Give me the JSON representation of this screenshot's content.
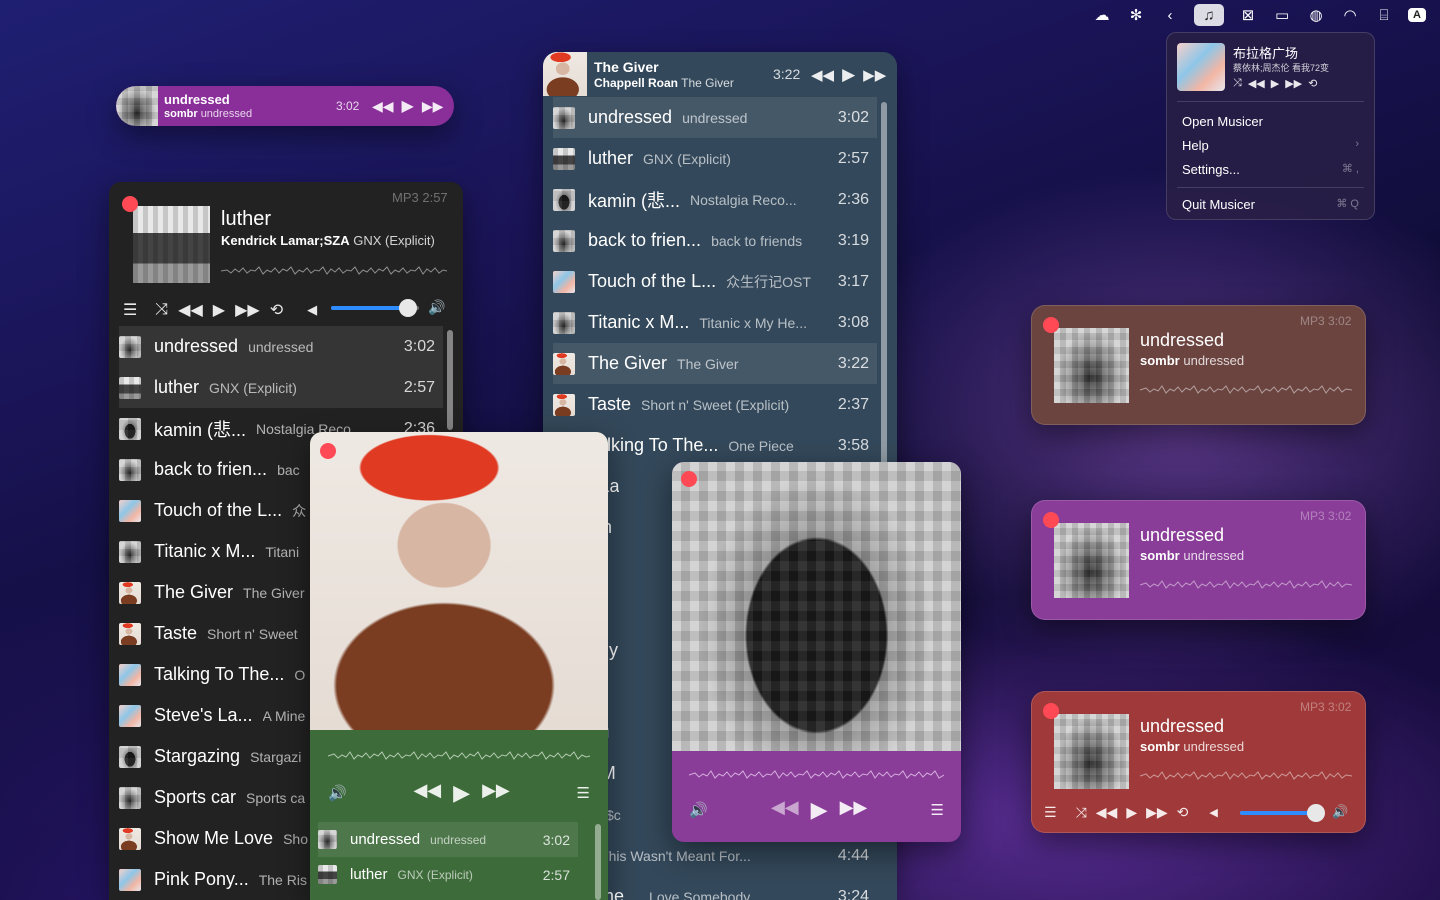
{
  "menubar": {
    "icons": [
      "cloud-icon",
      "pinwheel-icon",
      "chevron-left-icon",
      "music-note-icon",
      "wireframe-icon",
      "battery-charging-icon",
      "wechat-icon",
      "wifi-icon",
      "translate-icon"
    ],
    "input_source": "A"
  },
  "mini_bar": {
    "title": "undressed",
    "artist": "sombr",
    "album": "undressed",
    "duration": "3:02",
    "color": "#8a2f9a"
  },
  "left_window": {
    "format": "MP3",
    "time": "2:57",
    "title": "luther",
    "artist": "Kendrick Lamar;SZA",
    "album": "GNX (Explicit)",
    "volume_percent": 88
  },
  "top_window": {
    "title": "The Giver",
    "artist": "Chappell Roan",
    "album": "The Giver",
    "duration": "3:22"
  },
  "playlist": [
    {
      "title": "undressed",
      "album": "undressed",
      "dur": "3:02"
    },
    {
      "title": "luther",
      "album": "GNX (Explicit)",
      "dur": "2:57"
    },
    {
      "title": "kamin (悲...",
      "album": "Nostalgia Reco...",
      "dur": "2:36"
    },
    {
      "title": "back to frien...",
      "album": "back to friends",
      "dur": "3:19"
    },
    {
      "title": "Touch of the L...",
      "album": "众生行记OST",
      "dur": "3:17"
    },
    {
      "title": "Titanic x M...",
      "album": "Titanic x My He...",
      "dur": "3:08"
    },
    {
      "title": "The Giver",
      "album": "The Giver",
      "dur": "3:22"
    },
    {
      "title": "Taste",
      "album": "Short n' Sweet (Explicit)",
      "dur": "2:37"
    },
    {
      "title": "Talking To The...",
      "album": "One Piece",
      "dur": "3:58"
    }
  ],
  "left_list": [
    {
      "title": "undressed",
      "album": "undressed",
      "dur": "3:02"
    },
    {
      "title": "luther",
      "album": "GNX (Explicit)",
      "dur": "2:57"
    },
    {
      "title": "kamin (悲...",
      "album": "Nostalgia Reco...",
      "dur": "2:36"
    },
    {
      "title": "back to frien...",
      "album": "bac"
    },
    {
      "title": "Touch of the L...",
      "album": "众"
    },
    {
      "title": "Titanic x M...",
      "album": "Titani"
    },
    {
      "title": "The Giver",
      "album": "The Giver"
    },
    {
      "title": "Taste",
      "album": "Short n' Sweet"
    },
    {
      "title": "Talking To The...",
      "album": "O"
    },
    {
      "title": "Steve's La...",
      "album": "A Mine"
    },
    {
      "title": "Stargazing",
      "album": "Stargazi"
    },
    {
      "title": "Sports car",
      "album": "Sports ca"
    },
    {
      "title": "Show Me Love",
      "album": "Sho"
    },
    {
      "title": "Pink Pony...",
      "album": "The Ris"
    }
  ],
  "top_list_partial": [
    {
      "title": "eve's La",
      "album": ""
    },
    {
      "title": "argazin",
      "album": ""
    },
    {
      "title": "orts ca",
      "album": ""
    },
    {
      "title": "ow Me",
      "album": ""
    },
    {
      "title": "nk Pony",
      "album": ""
    },
    {
      "title": "dinary",
      "album": ""
    },
    {
      "title": "bit",
      "album": "Fool"
    },
    {
      "title": "ce To M",
      "album": ""
    },
    {
      "title": "OKIA",
      "album": "$c"
    },
    {
      "title": "essy",
      "album": "This Wasn't Meant For...",
      "dur": "4:44"
    },
    {
      "title": "ve Some...",
      "album": "Love Somebody",
      "dur": "3:24"
    }
  ],
  "green_window": {
    "list": [
      {
        "title": "undressed",
        "album": "undressed",
        "dur": "3:02"
      },
      {
        "title": "luther",
        "album": "GNX (Explicit)",
        "dur": "2:57"
      }
    ],
    "color": "#3d6b3a"
  },
  "purple_window": {
    "color": "#8a3d98"
  },
  "cards": [
    {
      "format": "MP3",
      "time": "3:02",
      "title": "undressed",
      "artist": "sombr",
      "album": "undressed",
      "color": "#6b4440"
    },
    {
      "format": "MP3",
      "time": "3:02",
      "title": "undressed",
      "artist": "sombr",
      "album": "undressed",
      "color": "#8a3d98"
    },
    {
      "format": "MP3",
      "time": "3:02",
      "title": "undressed",
      "artist": "sombr",
      "album": "undressed",
      "color": "#a03a3a",
      "volume_percent": 90
    }
  ],
  "menu": {
    "np_title": "布拉格广场",
    "np_artist": "蔡依林;周杰伦",
    "np_album": "看我72变",
    "items": [
      {
        "label": "Open Musicer",
        "key": ""
      },
      {
        "label": "Help",
        "key": "›"
      },
      {
        "label": "Settings...",
        "key": "⌘ ,"
      },
      {
        "label": "Quit Musicer",
        "key": "⌘ Q"
      }
    ]
  }
}
